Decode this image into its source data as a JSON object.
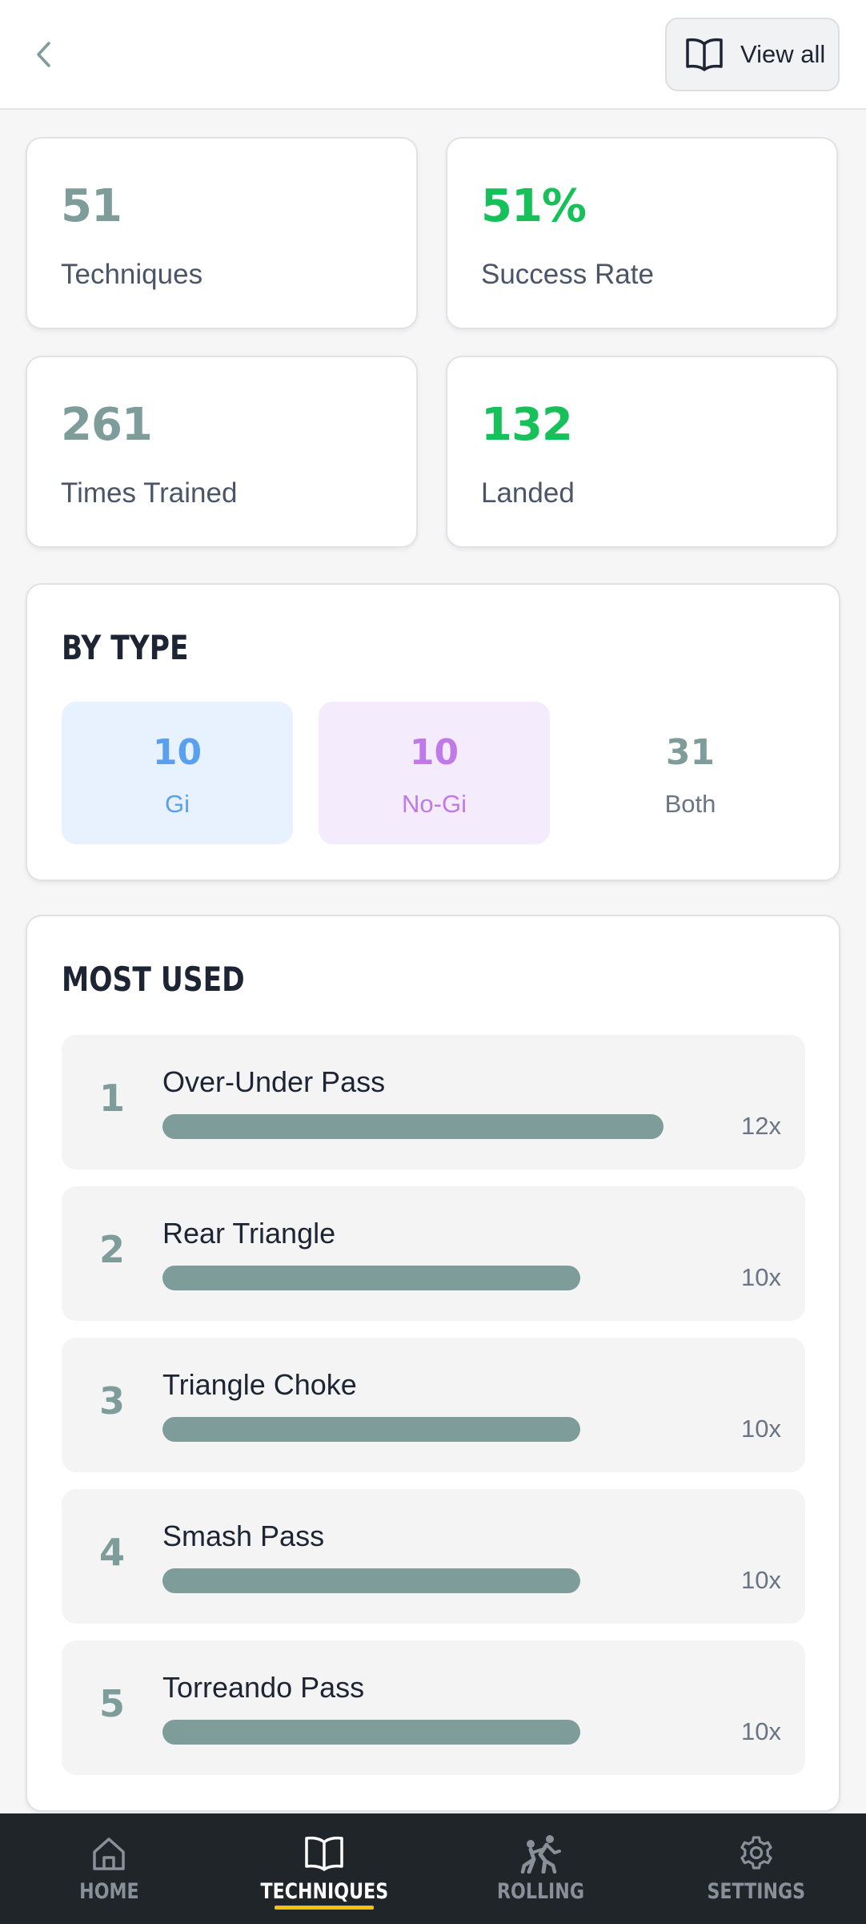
{
  "header": {
    "view_all_label": "View all"
  },
  "stats": [
    {
      "value": "51",
      "label": "Techniques",
      "color": "#7d9c9a"
    },
    {
      "value": "51%",
      "label": "Success Rate",
      "color": "#16c15a"
    },
    {
      "value": "261",
      "label": "Times Trained",
      "color": "#7d9c9a"
    },
    {
      "value": "132",
      "label": "Landed",
      "color": "#16c15a"
    }
  ],
  "by_type": {
    "title": "BY TYPE",
    "items": [
      {
        "value": "10",
        "label": "Gi",
        "color": "#5aa0ee",
        "bg": "#e8f2fe"
      },
      {
        "value": "10",
        "label": "No-Gi",
        "color": "#c07ae8",
        "bg": "#f4ebfd"
      },
      {
        "value": "31",
        "label": "Both",
        "color": "#7d9c9a",
        "bg": "#ffffff"
      }
    ]
  },
  "most_used": {
    "title": "MOST USED",
    "items": [
      {
        "rank": "1",
        "name": "Over-Under Pass",
        "count": "12x",
        "fraction": 0.87
      },
      {
        "rank": "2",
        "name": "Rear Triangle",
        "count": "10x",
        "fraction": 0.725
      },
      {
        "rank": "3",
        "name": "Triangle Choke",
        "count": "10x",
        "fraction": 0.725
      },
      {
        "rank": "4",
        "name": "Smash Pass",
        "count": "10x",
        "fraction": 0.725
      },
      {
        "rank": "5",
        "name": "Torreando Pass",
        "count": "10x",
        "fraction": 0.725
      }
    ]
  },
  "nav": {
    "items": [
      {
        "label": "HOME",
        "icon": "home-icon",
        "active": false
      },
      {
        "label": "TECHNIQUES",
        "icon": "book-icon",
        "active": true
      },
      {
        "label": "ROLLING",
        "icon": "grappling-icon",
        "active": false
      },
      {
        "label": "SETTINGS",
        "icon": "gear-icon",
        "active": false
      }
    ],
    "accent": "#f4c20d"
  }
}
